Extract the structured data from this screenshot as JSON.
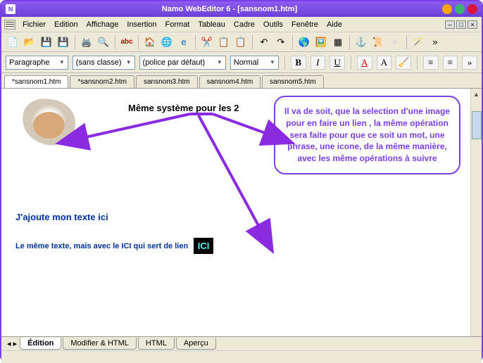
{
  "title": "Namo WebEditor 6 - [sansnom1.htm]",
  "menu": {
    "fichier": "Fichier",
    "edition": "Edition",
    "affichage": "Affichage",
    "insertion": "Insertion",
    "format": "Format",
    "tableau": "Tableau",
    "cadre": "Cadre",
    "outils": "Outils",
    "fenetre": "Fenêtre",
    "aide": "Aide"
  },
  "format": {
    "paragraphe": "Paragraphe",
    "classe": "(sans classe)",
    "police": "(police par défaut)",
    "normal": "Normal"
  },
  "tabs": [
    "*sansnom1.htm",
    "*sansnom2.htm",
    "sansnom3.htm",
    "sansnom4.htm",
    "sansnom5.htm"
  ],
  "doc": {
    "heading": "Même système pour les  2",
    "callout": "Il va de soit, que la selection d'une image pour en faire un lien , la même opération sera faite pour que ce soit un mot, une phrase, une icone, de la même manière, avec les même opérations à suivre",
    "line1": "J'ajoute mon texte ici",
    "line2": "Le même texte, mais avec le ICI qui sert de lien",
    "ici": "ICI"
  },
  "btabs": {
    "edition": "Édition",
    "modhtml": "Modifier & HTML",
    "html": "HTML",
    "apercu": "Aperçu"
  }
}
